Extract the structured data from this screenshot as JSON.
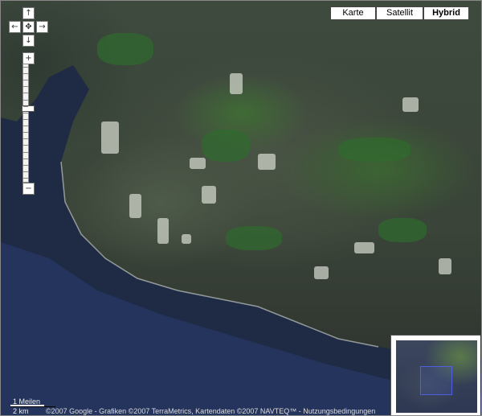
{
  "map_type_buttons": [
    {
      "label": "Karte",
      "active": false
    },
    {
      "label": "Satellit",
      "active": false
    },
    {
      "label": "Hybrid",
      "active": true
    }
  ],
  "nav_icons": {
    "up": "↑",
    "down": "↓",
    "left": "←",
    "right": "→",
    "center": "✥",
    "zoom_in": "+",
    "zoom_out": "−"
  },
  "scale": {
    "miles_label": "1 Meilen",
    "km_label": "2 km"
  },
  "copyright": {
    "text": "©2007 Google - Grafiken ©2007 TerraMetrics, Kartendaten ©2007 NAVTEQ™ - ",
    "terms_link": "Nutzungsbedingungen"
  },
  "zoom_level_fraction": 0.38,
  "colors": {
    "sea": "#1f2b44",
    "land": "#3e4a3e",
    "forest": "#2f6b2e",
    "overview_box": "#4f5fe0"
  }
}
